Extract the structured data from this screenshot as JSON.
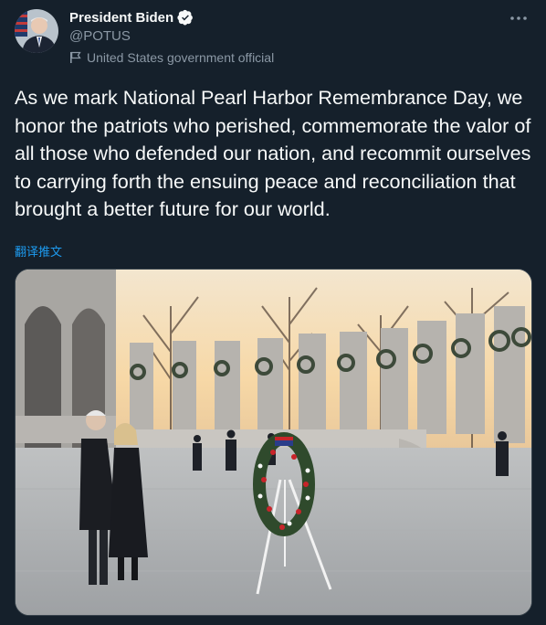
{
  "header": {
    "display_name": "President Biden",
    "handle": "@POTUS",
    "account_label": "United States government official"
  },
  "tweet": {
    "text": "As we mark National Pearl Harbor Remembrance Day, we honor the patriots who perished, commemorate the valor of all those who defended our nation, and recommit ourselves to carrying forth the ensuing peace and reconciliation that brought a better future for our world.",
    "translate_label": "翻译推文"
  },
  "colors": {
    "background": "#15202b",
    "text_primary": "#f7f9f9",
    "text_secondary": "#8b98a5",
    "link": "#1d9bf0",
    "verified": "#1d9bf0",
    "border": "#38444d"
  },
  "icons": {
    "verified": "verified-badge-icon",
    "flag": "flag-icon",
    "more": "more-icon"
  }
}
